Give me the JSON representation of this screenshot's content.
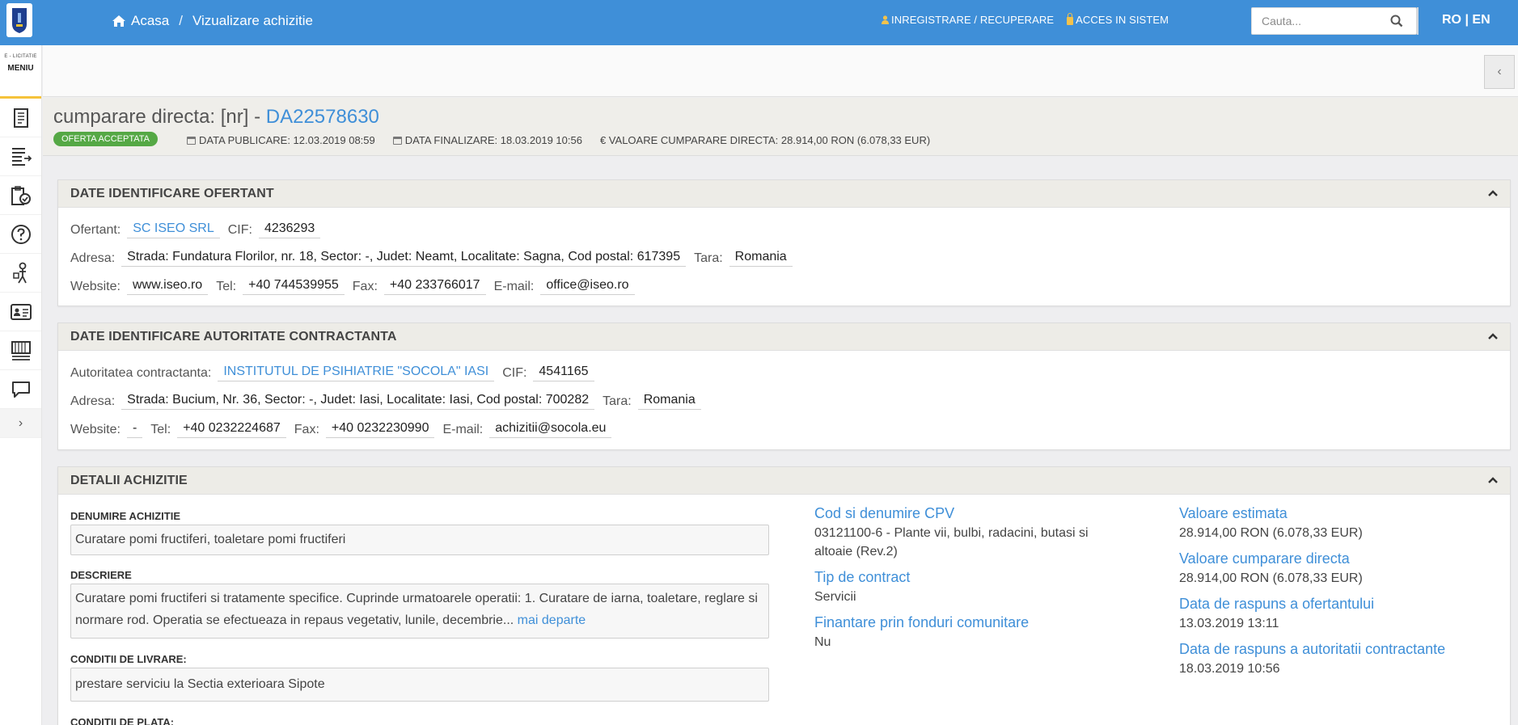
{
  "header": {
    "home_label": "Acasa",
    "separator": "/",
    "current_page": "Vizualizare achizitie",
    "register_label": "INREGISTRARE / RECUPERARE",
    "login_label": "ACCES IN SISTEM",
    "search_placeholder": "Cauta...",
    "lang_ro": "RO",
    "lang_sep": "|",
    "lang_en": "EN"
  },
  "sidebar": {
    "brand_small": "E - LICITATIE",
    "menu_label": "MENIU",
    "items": [
      {
        "icon": "document-icon"
      },
      {
        "icon": "list-export-icon"
      },
      {
        "icon": "clipboard-check-icon"
      },
      {
        "icon": "help-icon"
      },
      {
        "icon": "person-support-icon"
      },
      {
        "icon": "id-card-icon"
      },
      {
        "icon": "catalog-icon"
      },
      {
        "icon": "chat-icon"
      }
    ],
    "expand": "›"
  },
  "collapse_button": "‹",
  "procurement": {
    "title_prefix": "cumparare directa: [nr] -",
    "code": "DA22578630",
    "status": "OFERTA ACCEPTATA",
    "publish_date": "DATA PUBLICARE: 12.03.2019 08:59",
    "finalize_date": "DATA FINALIZARE: 18.03.2019 10:56",
    "value": "€ VALOARE CUMPARARE DIRECTA: 28.914,00  RON (6.078,33  EUR)"
  },
  "bidder": {
    "title": "DATE IDENTIFICARE OFERTANT",
    "ofertant_label": "Ofertant:",
    "ofertant": "SC ISEO SRL",
    "cif_label": "CIF:",
    "cif": "4236293",
    "address_label": "Adresa:",
    "address": "Strada: Fundatura Florilor, nr. 18, Sector: -, Judet: Neamt, Localitate: Sagna, Cod postal: 617395",
    "country_label": "Tara:",
    "country": "Romania",
    "website_label": "Website:",
    "website": "www.iseo.ro",
    "tel_label": "Tel:",
    "tel": "+40 744539955",
    "fax_label": "Fax:",
    "fax": "+40 233766017",
    "email_label": "E-mail:",
    "email": "office@iseo.ro"
  },
  "authority": {
    "title": "DATE IDENTIFICARE AUTORITATE CONTRACTANTA",
    "name_label": "Autoritatea contractanta:",
    "name": "INSTITUTUL DE PSIHIATRIE \"SOCOLA\" IASI",
    "cif_label": "CIF:",
    "cif": "4541165",
    "address_label": "Adresa:",
    "address": "Strada: Bucium, Nr. 36, Sector: -, Judet: Iasi, Localitate: Iasi, Cod postal: 700282",
    "country_label": "Tara:",
    "country": "Romania",
    "website_label": "Website:",
    "website": "-",
    "tel_label": "Tel:",
    "tel": "+40 0232224687",
    "fax_label": "Fax:",
    "fax": "+40 0232230990",
    "email_label": "E-mail:",
    "email": "achizitii@socola.eu"
  },
  "details": {
    "title": "DETALII ACHIZITIE",
    "name_label": "DENUMIRE ACHIZITIE",
    "name": "Curatare pomi fructiferi, toaletare pomi fructiferi",
    "description_label": "DESCRIERE",
    "description": "Curatare pomi fructiferi si tratamente specifice. Cuprinde urmatoarele operatii: 1. Curatare de iarna, toaletare, reglare si normare rod. Operatia se efectueaza in repaus vegetativ, lunile, decembrie...",
    "more_link": "mai departe",
    "delivery_label": "CONDITII DE LIVRARE:",
    "delivery": "prestare serviciu la Sectia exterioara Sipote",
    "payment_label": "CONDITII DE PLATA:",
    "cpv_title": "Cod si denumire CPV",
    "cpv": "03121100-6 - Plante vii, bulbi, radacini, butasi si altoaie (Rev.2)",
    "contract_type_title": "Tip de contract",
    "contract_type": "Servicii",
    "eu_funds_title": "Finantare prin fonduri comunitare",
    "eu_funds": "Nu",
    "estimated_title": "Valoare estimata",
    "estimated": "28.914,00  RON (6.078,33  EUR)",
    "direct_value_title": "Valoare cumparare directa",
    "direct_value": "28.914,00  RON (6.078,33  EUR)",
    "bidder_reply_title": "Data de raspuns a ofertantului",
    "bidder_reply": "13.03.2019 13:11",
    "authority_reply_title": "Data de raspuns a autoritatii contractante",
    "authority_reply": "18.03.2019 10:56"
  },
  "colors": {
    "topbar": "#3f8fd8",
    "link": "#3f8fd8",
    "badge": "#55a845",
    "accent_yellow": "#f5c33b"
  }
}
